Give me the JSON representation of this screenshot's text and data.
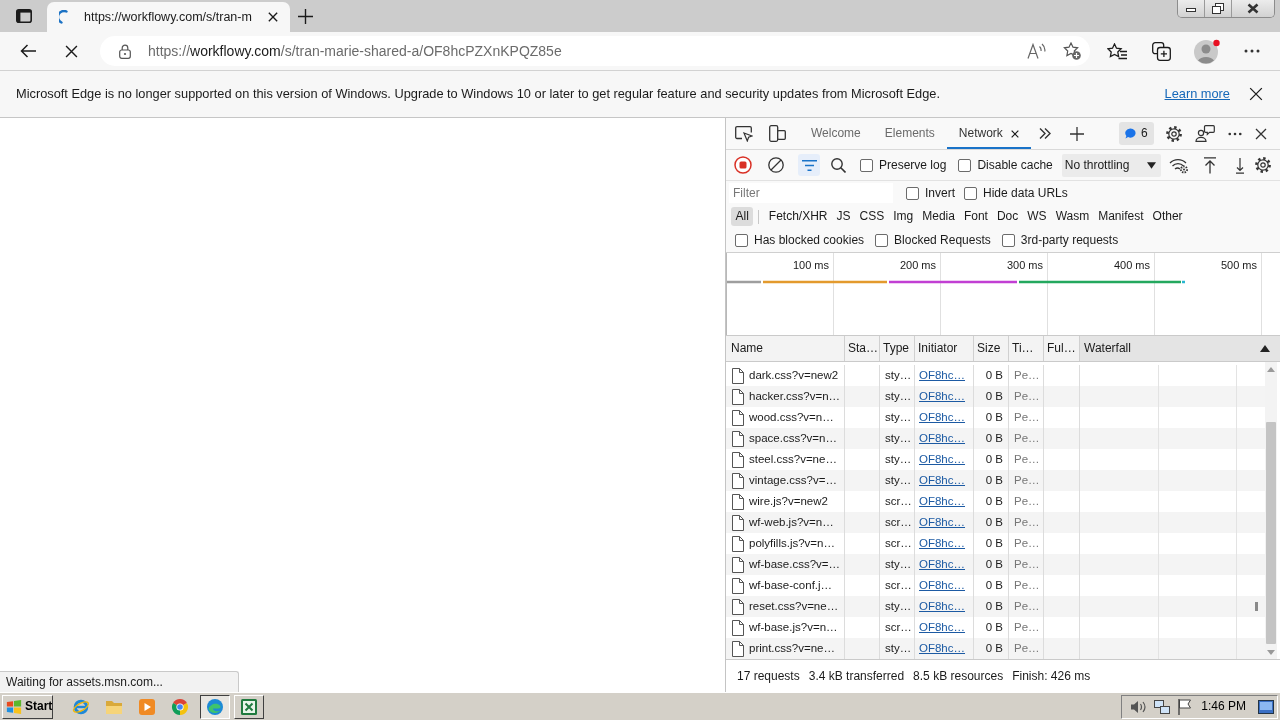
{
  "browser": {
    "tabs": [
      {
        "title": "https://workflowy.com/s/tran-m",
        "selected": true
      }
    ],
    "page_loading": true,
    "address": {
      "scheme": "https://",
      "host": "workflowy.com",
      "path": "/s/tran-marie-shared-a/OF8hcPZXnKPQZ85e"
    }
  },
  "infobar": {
    "message": "Microsoft Edge is no longer supported on this version of Windows. Upgrade to Windows 10 or later to get regular feature and security updates from Microsoft Edge.",
    "link": "Learn more"
  },
  "page": {
    "status": "Waiting for assets.msn.com..."
  },
  "devtools": {
    "tabs": [
      {
        "label": "Welcome",
        "selected": false
      },
      {
        "label": "Elements",
        "selected": false
      },
      {
        "label": "Network",
        "selected": true
      }
    ],
    "issues_count": "6",
    "toolbar": {
      "recording": true,
      "filter_open": true,
      "checkboxes": [
        {
          "label": "Preserve log",
          "checked": false
        },
        {
          "label": "Disable cache",
          "checked": false
        }
      ],
      "throttling": "No throttling"
    },
    "filter": {
      "placeholder": "Filter",
      "checkboxes": [
        {
          "label": "Invert",
          "checked": false
        },
        {
          "label": "Hide data URLs",
          "checked": false
        }
      ]
    },
    "types": [
      {
        "label": "All",
        "selected": true
      },
      {
        "label": "Fetch/XHR",
        "selected": false
      },
      {
        "label": "JS",
        "selected": false
      },
      {
        "label": "CSS",
        "selected": false
      },
      {
        "label": "Img",
        "selected": false
      },
      {
        "label": "Media",
        "selected": false
      },
      {
        "label": "Font",
        "selected": false
      },
      {
        "label": "Doc",
        "selected": false
      },
      {
        "label": "WS",
        "selected": false
      },
      {
        "label": "Wasm",
        "selected": false
      },
      {
        "label": "Manifest",
        "selected": false
      },
      {
        "label": "Other",
        "selected": false
      }
    ],
    "request_checkboxes": [
      {
        "label": "Has blocked cookies",
        "checked": false
      },
      {
        "label": "Blocked Requests",
        "checked": false
      },
      {
        "label": "3rd-party requests",
        "checked": false
      }
    ],
    "overview": {
      "ticks": [
        "100 ms",
        "200 ms",
        "300 ms",
        "400 ms",
        "500 ms"
      ]
    },
    "table": {
      "columns": [
        {
          "label": "Name",
          "sorted": false
        },
        {
          "label": "Sta…",
          "sorted": false
        },
        {
          "label": "Type",
          "sorted": false
        },
        {
          "label": "Initiator",
          "sorted": false
        },
        {
          "label": "Size",
          "sorted": false
        },
        {
          "label": "Ti…",
          "sorted": false
        },
        {
          "label": "Ful…",
          "sorted": false
        },
        {
          "label": "Waterfall",
          "sorted": true,
          "ascending": true
        }
      ],
      "rows": [
        {
          "name": "dark.css?v=new2",
          "type": "sty…",
          "initiator": "OF8hc…",
          "size": "0 B",
          "time": "Pe…",
          "waterfall_bar": false
        },
        {
          "name": "hacker.css?v=n…",
          "type": "sty…",
          "initiator": "OF8hc…",
          "size": "0 B",
          "time": "Pe…",
          "waterfall_bar": false
        },
        {
          "name": "wood.css?v=n…",
          "type": "sty…",
          "initiator": "OF8hc…",
          "size": "0 B",
          "time": "Pe…",
          "waterfall_bar": false
        },
        {
          "name": "space.css?v=n…",
          "type": "sty…",
          "initiator": "OF8hc…",
          "size": "0 B",
          "time": "Pe…",
          "waterfall_bar": false
        },
        {
          "name": "steel.css?v=ne…",
          "type": "sty…",
          "initiator": "OF8hc…",
          "size": "0 B",
          "time": "Pe…",
          "waterfall_bar": false
        },
        {
          "name": "vintage.css?v=…",
          "type": "sty…",
          "initiator": "OF8hc…",
          "size": "0 B",
          "time": "Pe…",
          "waterfall_bar": false
        },
        {
          "name": "wire.js?v=new2",
          "type": "scr…",
          "initiator": "OF8hc…",
          "size": "0 B",
          "time": "Pe…",
          "waterfall_bar": false
        },
        {
          "name": "wf-web.js?v=n…",
          "type": "scr…",
          "initiator": "OF8hc…",
          "size": "0 B",
          "time": "Pe…",
          "waterfall_bar": false
        },
        {
          "name": "polyfills.js?v=n…",
          "type": "scr…",
          "initiator": "OF8hc…",
          "size": "0 B",
          "time": "Pe…",
          "waterfall_bar": false
        },
        {
          "name": "wf-base.css?v=…",
          "type": "sty…",
          "initiator": "OF8hc…",
          "size": "0 B",
          "time": "Pe…",
          "waterfall_bar": false
        },
        {
          "name": "wf-base-conf.j…",
          "type": "scr…",
          "initiator": "OF8hc…",
          "size": "0 B",
          "time": "Pe…",
          "waterfall_bar": false
        },
        {
          "name": "reset.css?v=ne…",
          "type": "sty…",
          "initiator": "OF8hc…",
          "size": "0 B",
          "time": "Pe…",
          "waterfall_bar": true
        },
        {
          "name": "wf-base.js?v=n…",
          "type": "scr…",
          "initiator": "OF8hc…",
          "size": "0 B",
          "time": "Pe…",
          "waterfall_bar": false
        },
        {
          "name": "print.css?v=ne…",
          "type": "sty…",
          "initiator": "OF8hc…",
          "size": "0 B",
          "time": "Pe…",
          "waterfall_bar": false
        }
      ]
    },
    "summary": [
      "17 requests",
      "3.4 kB transferred",
      "8.5 kB resources",
      "Finish: 426 ms"
    ]
  },
  "taskbar": {
    "start": "Start",
    "apps": [
      {
        "kind": "ie",
        "open": false,
        "selected": false
      },
      {
        "kind": "explorer",
        "open": false,
        "selected": false
      },
      {
        "kind": "media",
        "open": false,
        "selected": false
      },
      {
        "kind": "chrome",
        "open": false,
        "selected": false
      },
      {
        "kind": "edge",
        "open": true,
        "selected": true
      },
      {
        "kind": "excel",
        "open": true,
        "selected": false
      }
    ],
    "clock": "1:46 PM"
  }
}
